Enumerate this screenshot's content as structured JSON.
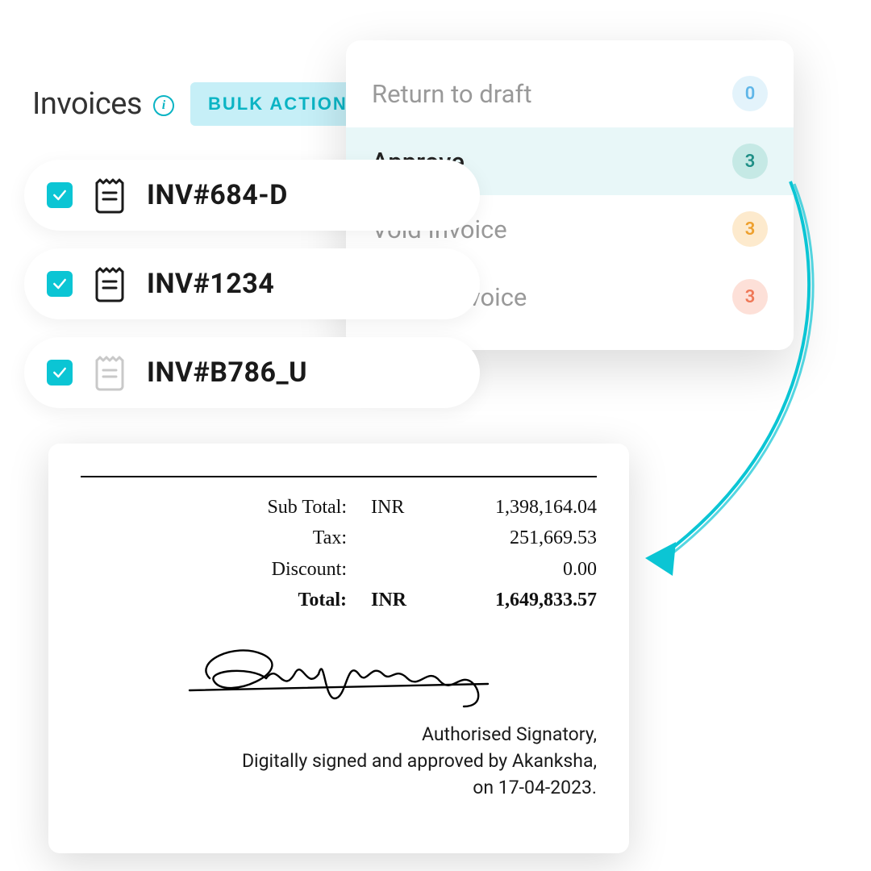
{
  "header": {
    "title": "Invoices",
    "bulk_label": "BULK ACTIONS"
  },
  "dropdown": {
    "items": [
      {
        "label": "Return to draft",
        "count": "0"
      },
      {
        "label": "Approve",
        "count": "3"
      },
      {
        "label": "Void Invoice",
        "count": "3"
      },
      {
        "label": "Delete invoice",
        "count": "3"
      }
    ]
  },
  "invoices": [
    {
      "label": "INV#684-D"
    },
    {
      "label": "INV#1234"
    },
    {
      "label": "INV#B786_U"
    }
  ],
  "receipt": {
    "rows": [
      {
        "label": "Sub Total:",
        "currency": "INR",
        "value": "1,398,164.04"
      },
      {
        "label": "Tax:",
        "currency": "",
        "value": "251,669.53"
      },
      {
        "label": "Discount:",
        "currency": "",
        "value": "0.00"
      },
      {
        "label": "Total:",
        "currency": "INR",
        "value": "1,649,833.57"
      }
    ],
    "sign_line1": "Authorised Signatory,",
    "sign_line2": "Digitally signed and approved by Akanksha,",
    "sign_line3": "on 17-04-2023."
  }
}
